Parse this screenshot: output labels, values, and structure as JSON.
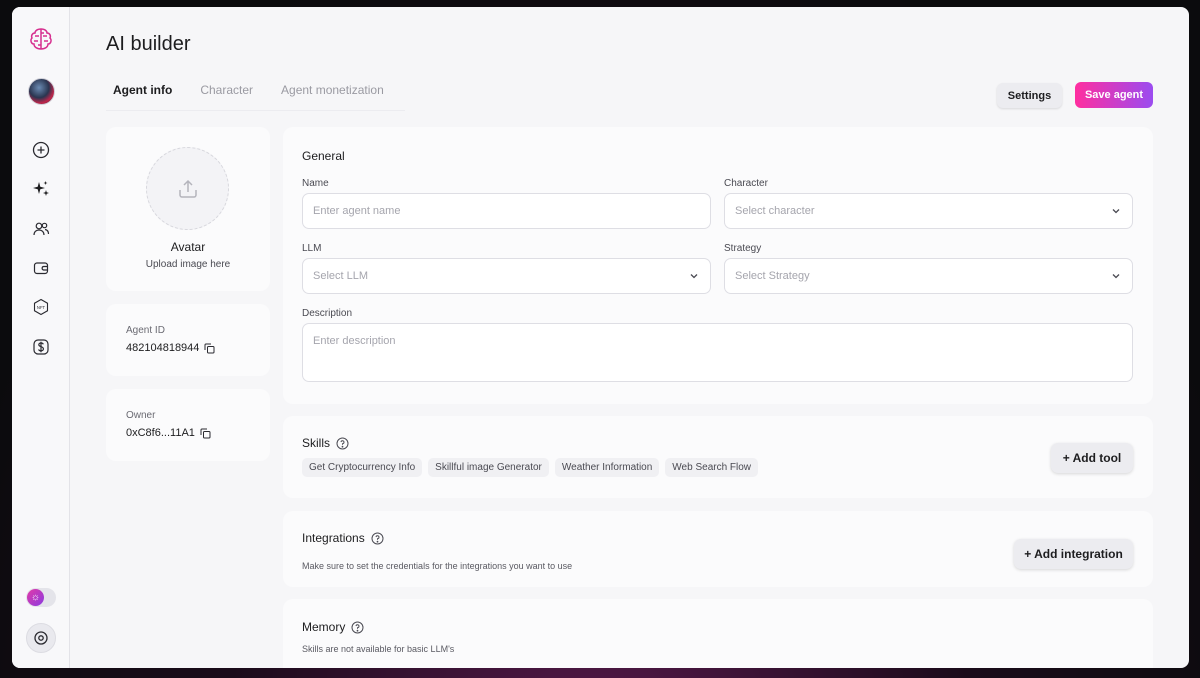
{
  "page": {
    "title": "AI builder"
  },
  "tabs": [
    {
      "label": "Agent info",
      "active": true
    },
    {
      "label": "Character",
      "active": false
    },
    {
      "label": "Agent monetization",
      "active": false
    }
  ],
  "actions": {
    "settings_label": "Settings",
    "save_label": "Save agent"
  },
  "sidebar": {
    "icons": [
      "brain-logo-icon",
      "avatar",
      "plus-circle-icon",
      "sparkles-icon",
      "users-icon",
      "wallet-icon",
      "nft-icon",
      "dollar-icon"
    ],
    "bottom": [
      "theme-toggle",
      "settings-circle-icon"
    ]
  },
  "avatar_card": {
    "title": "Avatar",
    "subtitle": "Upload image here"
  },
  "agent_id": {
    "label": "Agent ID",
    "value": "482104818944"
  },
  "owner": {
    "label": "Owner",
    "value": "0xC8f6...11A1"
  },
  "general": {
    "title": "General",
    "name": {
      "label": "Name",
      "placeholder": "Enter agent name"
    },
    "character": {
      "label": "Character",
      "placeholder": "Select character"
    },
    "llm": {
      "label": "LLM",
      "placeholder": "Select LLM"
    },
    "strategy": {
      "label": "Strategy",
      "placeholder": "Select Strategy"
    },
    "description": {
      "label": "Description",
      "placeholder": "Enter description"
    }
  },
  "skills": {
    "title": "Skills",
    "items": [
      "Get Cryptocurrency Info",
      "Skillful image Generator",
      "Weather Information",
      "Web Search Flow"
    ],
    "add_label": "+ Add tool"
  },
  "integrations": {
    "title": "Integrations",
    "subtitle": "Make sure to set the credentials for the integrations you want to use",
    "add_label": "+ Add integration"
  },
  "memory": {
    "title": "Memory",
    "subtitle": "Skills are not available for basic LLM's"
  },
  "colors": {
    "accent_start": "#ff2e9f",
    "accent_end": "#9b4cf0",
    "brand": "#d6308f"
  }
}
